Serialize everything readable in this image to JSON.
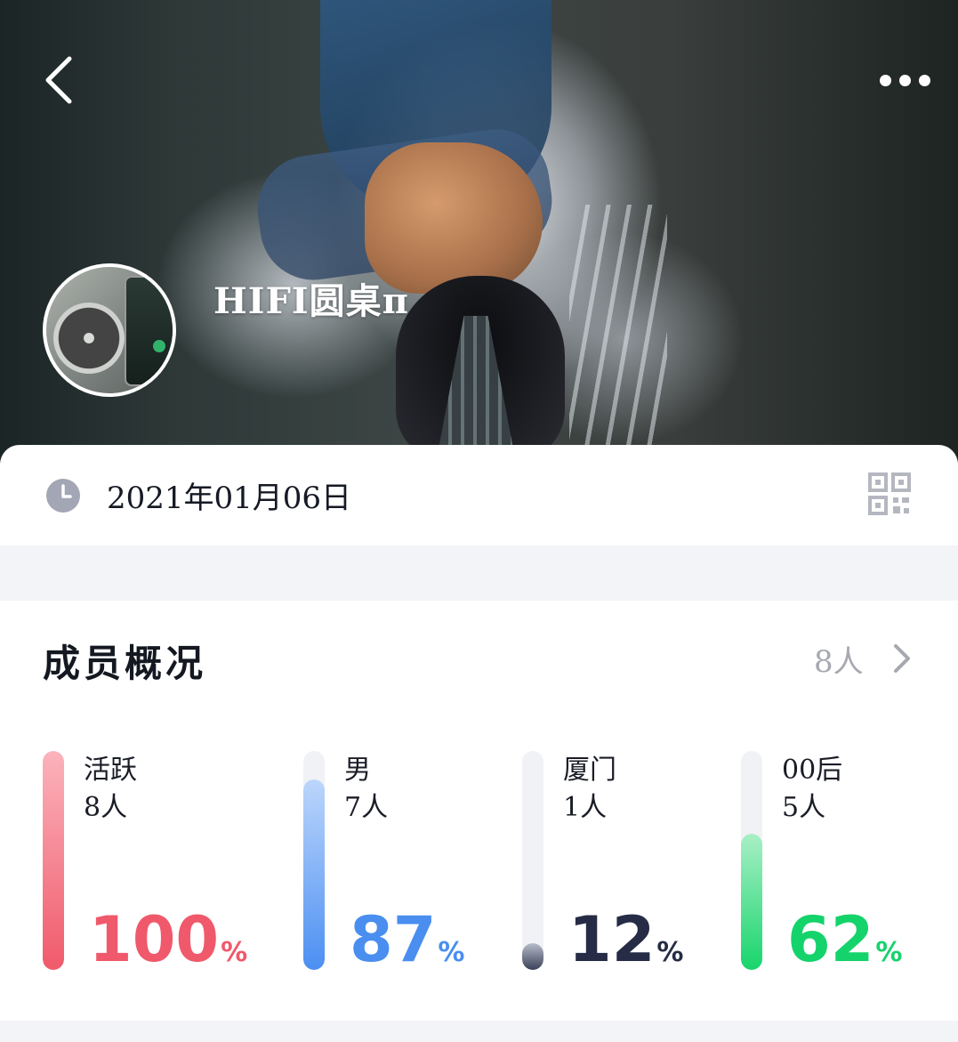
{
  "header": {
    "group_name": "HIFI圆桌π"
  },
  "info": {
    "date": "2021年01月06日"
  },
  "members": {
    "title": "成员概况",
    "count": "8人",
    "stats": [
      {
        "label": "活跃",
        "count": "8人",
        "percent": "100",
        "unit": "%",
        "fraction": 1.0,
        "color": "#f0596b",
        "fill_top": "#fbb3bc",
        "fill_bottom": "#f05a6b"
      },
      {
        "label": "男",
        "count": "7人",
        "percent": "87",
        "unit": "%",
        "fraction": 0.87,
        "color": "#4a8ef0",
        "fill_top": "#bcd6fb",
        "fill_bottom": "#4c8ff2"
      },
      {
        "label": "厦门",
        "count": "1人",
        "percent": "12",
        "unit": "%",
        "fraction": 0.12,
        "color": "#262c45",
        "fill_top": "#b7bcc9",
        "fill_bottom": "#3a4158"
      },
      {
        "label": "00后",
        "count": "5人",
        "percent": "62",
        "unit": "%",
        "fraction": 0.62,
        "color": "#15d36b",
        "fill_top": "#a8efc6",
        "fill_bottom": "#18d56c"
      }
    ]
  }
}
